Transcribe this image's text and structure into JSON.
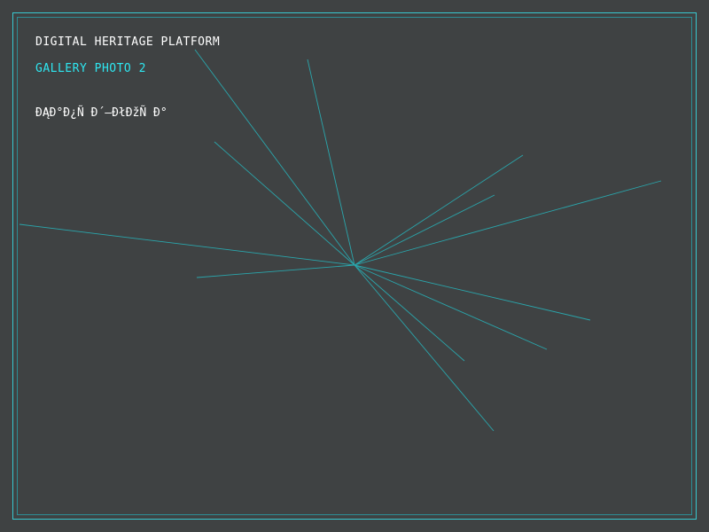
{
  "header": {
    "platform_title": "DIGITAL HERITAGE PLATFORM",
    "gallery_label": "GALLERY PHOTO 2",
    "encoded_text": "ÐĄÐ°Ð¿Ñ Ð´–ÐłÐžÑ Ð°"
  },
  "colors": {
    "background": "#3f4243",
    "accent": "#2ee6f0",
    "frame": "#38c8d0",
    "lines": "#2aa6ac",
    "text": "#ffffff"
  }
}
